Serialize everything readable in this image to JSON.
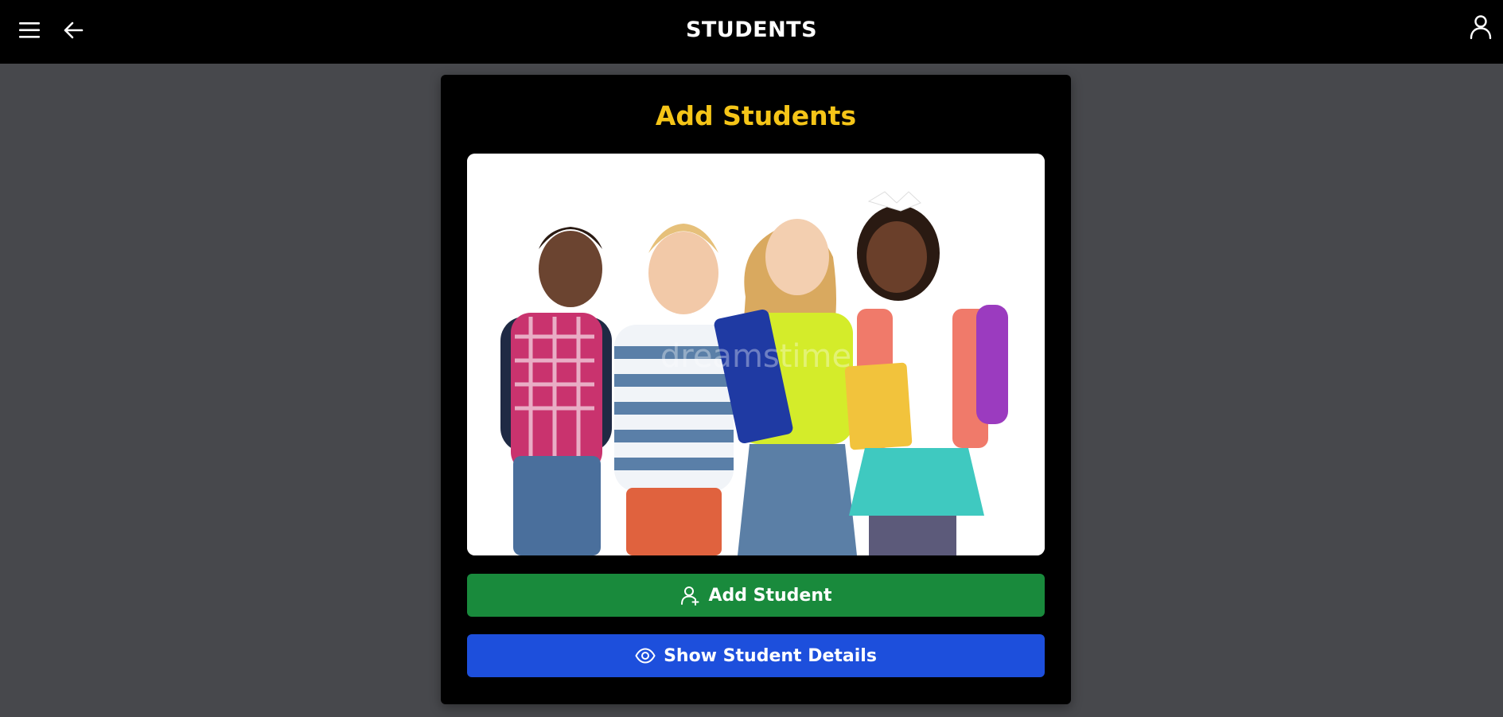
{
  "header": {
    "title": "STUDENTS",
    "menu_icon": "hamburger-menu-icon",
    "back_icon": "arrow-left-icon",
    "profile_icon": "user-icon"
  },
  "card": {
    "title": "Add Students",
    "image_alt": "Group of four smiling children with school backpacks and notebooks",
    "watermark": "dreamstime",
    "buttons": {
      "add_student": {
        "label": "Add Student",
        "icon": "user-plus-icon"
      },
      "show_details": {
        "label": "Show Student Details",
        "icon": "eye-icon"
      }
    }
  },
  "colors": {
    "header_bg": "#000000",
    "page_bg": "#47484c",
    "card_bg": "#000000",
    "accent_title": "#f5c518",
    "add_button": "#198a3c",
    "details_button": "#1d4fdc"
  }
}
